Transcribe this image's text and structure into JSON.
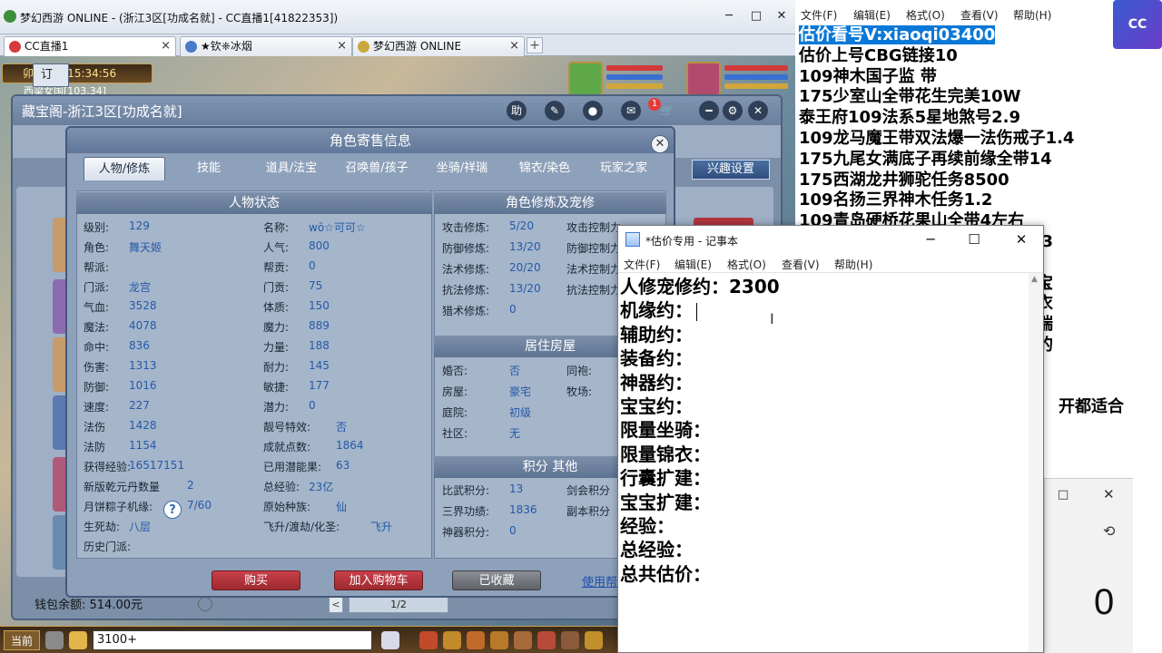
{
  "game": {
    "window_title": "梦幻西游 ONLINE - (浙江3区[功成名就] - CC直播1[41822353])",
    "tabs": [
      {
        "label": "CC直播1",
        "color": "#d83b3b"
      },
      {
        "label": "★钦❈冰烟",
        "color": "#4b79c9"
      },
      {
        "label": "梦幻西游 ONLINE",
        "color": "#c9a83b"
      }
    ],
    "time": "卯时(夜) 15:34:56",
    "map": "西梁女国[103,34]",
    "cbg": {
      "title": "藏宝阁-浙江3区[功成名就]",
      "notif_count": "1",
      "order_tab": "订",
      "dialog_title": "角色寄售信息",
      "dialog_tabs": [
        "人物/修炼",
        "技能",
        "道具/法宝",
        "召唤兽/孩子",
        "坐骑/祥瑞",
        "锦衣/染色",
        "玩家之家"
      ],
      "interest_button": "兴趣设置",
      "status_header": "人物状态",
      "status_left": [
        {
          "label": "级别:",
          "value": "129"
        },
        {
          "label": "角色:",
          "value": "舞天姬"
        },
        {
          "label": "帮派:",
          "value": ""
        },
        {
          "label": "门派:",
          "value": "龙宫"
        },
        {
          "label": "气血:",
          "value": "3528"
        },
        {
          "label": "魔法:",
          "value": "4078"
        },
        {
          "label": "命中:",
          "value": "836"
        },
        {
          "label": "伤害:",
          "value": "1313"
        },
        {
          "label": "防御:",
          "value": "1016"
        },
        {
          "label": "速度:",
          "value": "227"
        },
        {
          "label": "法伤",
          "value": "1428"
        },
        {
          "label": "法防",
          "value": "1154"
        },
        {
          "label": "获得经验:",
          "value": "16517151"
        },
        {
          "label": "新版乾元丹数量",
          "value": "2"
        },
        {
          "label": "月饼粽子机缘:",
          "value": "7/60"
        },
        {
          "label": "生死劫:",
          "value": "八层"
        },
        {
          "label": "历史门派:",
          "value": ""
        }
      ],
      "status_right": [
        {
          "label": "名称:",
          "value": "wō☆可可☆"
        },
        {
          "label": "人气:",
          "value": "800"
        },
        {
          "label": "帮贡:",
          "value": "0"
        },
        {
          "label": "门贡:",
          "value": "75"
        },
        {
          "label": "体质:",
          "value": "150"
        },
        {
          "label": "魔力:",
          "value": "889"
        },
        {
          "label": "力量:",
          "value": "188"
        },
        {
          "label": "耐力:",
          "value": "145"
        },
        {
          "label": "敏捷:",
          "value": "177"
        },
        {
          "label": "潜力:",
          "value": "0"
        },
        {
          "label": "靓号特效:",
          "value": "否"
        },
        {
          "label": "成就点数:",
          "value": "1864"
        },
        {
          "label": "已用潜能果:",
          "value": "63"
        },
        {
          "label": "总经验:",
          "value": "23亿"
        },
        {
          "label": "原始种族:",
          "value": "仙"
        },
        {
          "label": "飞升/渡劫/化圣:",
          "value": "飞升"
        }
      ],
      "cultivation_header": "角色修炼及宠修",
      "cultivation": [
        {
          "label": "攻击修炼:",
          "value": "5/20",
          "label2": "攻击控制力"
        },
        {
          "label": "防御修炼:",
          "value": "13/20",
          "label2": "防御控制力"
        },
        {
          "label": "法术修炼:",
          "value": "20/20",
          "label2": "法术控制力"
        },
        {
          "label": "抗法修炼:",
          "value": "13/20",
          "label2": "抗法控制力"
        },
        {
          "label": "猎术修炼:",
          "value": "0",
          "label2": ""
        }
      ],
      "house_header": "居住房屋",
      "house": [
        {
          "label": "婚否:",
          "value": "否",
          "label2": "同袍:"
        },
        {
          "label": "房屋:",
          "value": "豪宅",
          "label2": "牧场:"
        },
        {
          "label": "庭院:",
          "value": "初级",
          "label2": ""
        },
        {
          "label": "社区:",
          "value": "无",
          "label2": ""
        }
      ],
      "score_header": "积分 其他",
      "score": [
        {
          "label": "比武积分:",
          "value": "13",
          "label2": "剑会积分"
        },
        {
          "label": "三界功绩:",
          "value": "1836",
          "label2": "副本积分"
        },
        {
          "label": "神器积分:",
          "value": "0",
          "label2": ""
        }
      ],
      "buttons": {
        "buy": "购买",
        "cart": "加入购物车",
        "fav": "已收藏",
        "help": "使用帮助"
      },
      "wallet": "钱包余额: 514.00元",
      "page": "1/2"
    },
    "bottom": {
      "current": "当前",
      "chat_value": "3100+"
    }
  },
  "notepad_right": {
    "menu": [
      "文件(F)",
      "编辑(E)",
      "格式(O)",
      "查看(V)",
      "帮助(H)"
    ],
    "lines": [
      "估价看号V:xiaoqi03400",
      "估价上号CBG链接10",
      "109神木国子监 带",
      "175少室山全带花生完美10W",
      "泰王府109法系5星地煞号2.9",
      "109龙马魔王带双法爆一法伤戒子1.4",
      "175九尾女满底子再续前缘全带14",
      "175西湖龙井狮驼任务8500",
      "109名扬三界神木任务1.2",
      "109青岛硬桥花果山全带4左右",
      "5.3",
      "",
      "宝宝",
      "锦衣",
      "端",
      "右的",
      "",
      "",
      "开都适合"
    ]
  },
  "calculator": {
    "display": "0"
  },
  "notepad_front": {
    "title": "*估价专用 - 记事本",
    "menu": [
      "文件(F)",
      "编辑(E)",
      "格式(O)",
      "查看(V)",
      "帮助(H)"
    ],
    "lines": [
      "人修宠修约：2300",
      "机缘约：",
      "辅助约：",
      "装备约：",
      "神器约：",
      "宝宝约：",
      "限量坐骑：",
      "限量锦衣：",
      "行囊扩建：",
      "宝宝扩建：",
      "经验：",
      "总经验：",
      "总共估价："
    ]
  }
}
